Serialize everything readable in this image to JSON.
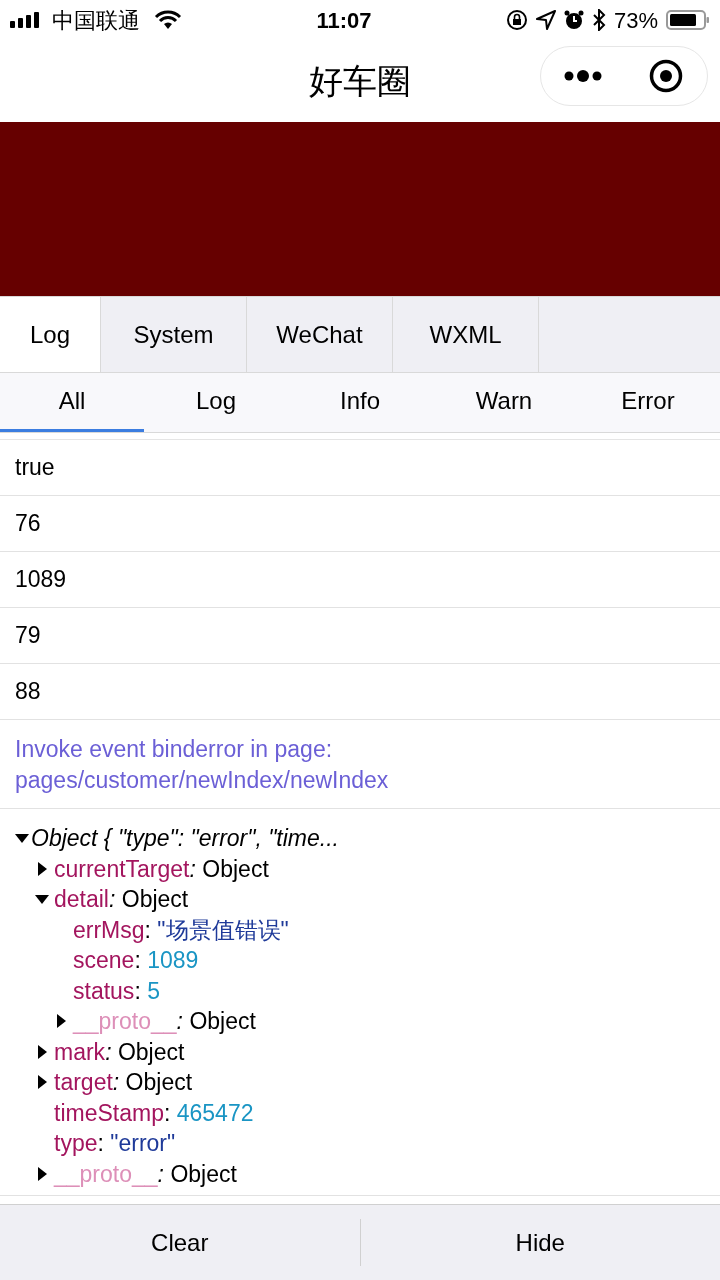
{
  "status_bar": {
    "carrier": "中国联通",
    "time": "11:07",
    "battery": "73%"
  },
  "nav": {
    "title": "好车圈"
  },
  "tabs": [
    {
      "label": "Log",
      "selected": true
    },
    {
      "label": "System",
      "selected": false
    },
    {
      "label": "WeChat",
      "selected": false
    },
    {
      "label": "WXML",
      "selected": false
    }
  ],
  "filters": [
    {
      "label": "All",
      "selected": true
    },
    {
      "label": "Log",
      "selected": false
    },
    {
      "label": "Info",
      "selected": false
    },
    {
      "label": "Warn",
      "selected": false
    },
    {
      "label": "Error",
      "selected": false
    }
  ],
  "logs": [
    {
      "kind": "plain",
      "text": "true"
    },
    {
      "kind": "plain",
      "text": "76"
    },
    {
      "kind": "plain",
      "text": "1089"
    },
    {
      "kind": "plain",
      "text": "79"
    },
    {
      "kind": "plain",
      "text": "88"
    },
    {
      "kind": "info",
      "text": "Invoke event binderror in page: pages/customer/newIndex/newIndex"
    },
    {
      "kind": "tree",
      "tree": {
        "summary": "Object { \"type\": \"error\", \"time...",
        "expanded": true,
        "children": [
          {
            "key": "currentTarget",
            "sep": ":",
            "value": "Object",
            "kind": "object",
            "expanded": false
          },
          {
            "key": "detail",
            "sep": ":",
            "value": "Object",
            "kind": "object",
            "expanded": true,
            "children": [
              {
                "key": "errMsg",
                "sep": ":",
                "value": "\"场景值错误\"",
                "kind": "string"
              },
              {
                "key": "scene",
                "sep": ":",
                "value": "1089",
                "kind": "number"
              },
              {
                "key": "status",
                "sep": ":",
                "value": "5",
                "kind": "number"
              },
              {
                "key": "__proto__",
                "sep": ":",
                "value": "Object",
                "kind": "object",
                "expanded": false,
                "dim": true
              }
            ]
          },
          {
            "key": "mark",
            "sep": ":",
            "value": "Object",
            "kind": "object",
            "expanded": false
          },
          {
            "key": "target",
            "sep": ":",
            "value": "Object",
            "kind": "object",
            "expanded": false
          },
          {
            "key": "timeStamp",
            "sep": ":",
            "value": "465472",
            "kind": "number"
          },
          {
            "key": "type",
            "sep": ":",
            "value": "\"error\"",
            "kind": "string"
          },
          {
            "key": "__proto__",
            "sep": ":",
            "value": "Object",
            "kind": "object",
            "expanded": false,
            "dim": true
          }
        ]
      }
    }
  ],
  "buttons": [
    {
      "label": "Clear"
    },
    {
      "label": "Hide"
    }
  ]
}
